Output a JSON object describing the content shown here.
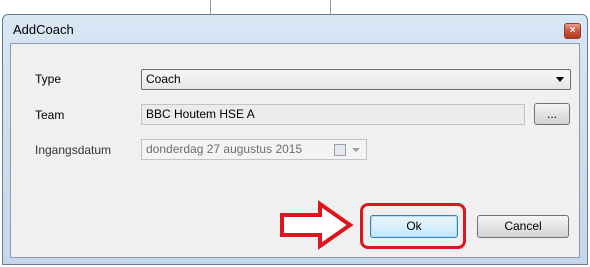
{
  "dialog": {
    "title": "AddCoach",
    "close_label": "×"
  },
  "form": {
    "type_label": "Type",
    "type_value": "Coach",
    "team_label": "Team",
    "team_value": "BBC Houtem HSE A",
    "team_browse_label": "...",
    "date_label": "Ingangsdatum",
    "date_value": "donderdag 27 augustus 2015"
  },
  "buttons": {
    "ok_label": "Ok",
    "cancel_label": "Cancel"
  },
  "colors": {
    "annotation": "#e0141e",
    "ok_border": "#3c7fb1"
  }
}
